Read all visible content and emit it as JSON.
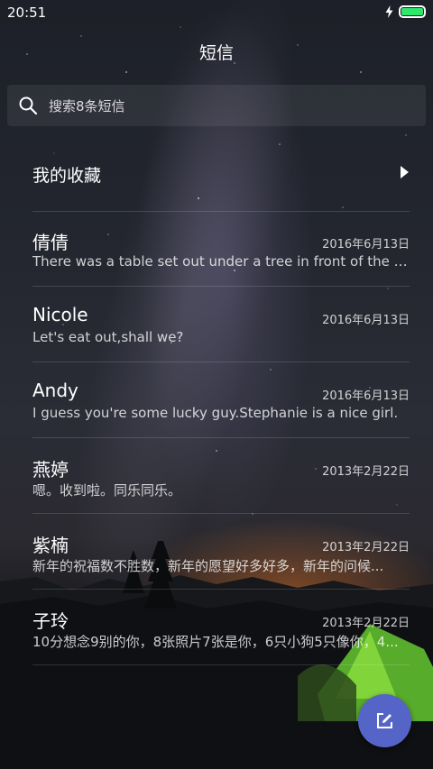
{
  "status_bar": {
    "time": "20:51",
    "charging_icon": "lightning-icon",
    "battery_icon": "battery-icon",
    "battery_level": 1.0,
    "battery_color": "#2ee86b"
  },
  "header": {
    "title": "短信"
  },
  "search": {
    "icon": "search-icon",
    "placeholder": "搜索8条短信"
  },
  "favorites": {
    "label": "我的收藏",
    "icon": "chevron-right-icon"
  },
  "conversations": [
    {
      "name": "倩倩",
      "date": "2016年6月13日",
      "preview": "There was a table set out under a tree in front of the ho..."
    },
    {
      "name": "Nicole",
      "date": "2016年6月13日",
      "preview": "Let's eat out,shall we?"
    },
    {
      "name": "Andy",
      "date": "2016年6月13日",
      "preview": "I guess you're some lucky guy.Stephanie is a nice girl."
    },
    {
      "name": "燕婷",
      "date": "2013年2月22日",
      "preview": "嗯。收到啦。同乐同乐。"
    },
    {
      "name": "紫楠",
      "date": "2013年2月22日",
      "preview": "新年的祝福数不胜数，新年的愿望好多好多，新年的问候..."
    },
    {
      "name": "子玲",
      "date": "2013年2月22日",
      "preview": "10分想念9别的你，8张照片7张是你，6只小狗5只像你，4..."
    }
  ],
  "compose_button": {
    "icon": "compose-icon",
    "color": "#5564c7"
  }
}
